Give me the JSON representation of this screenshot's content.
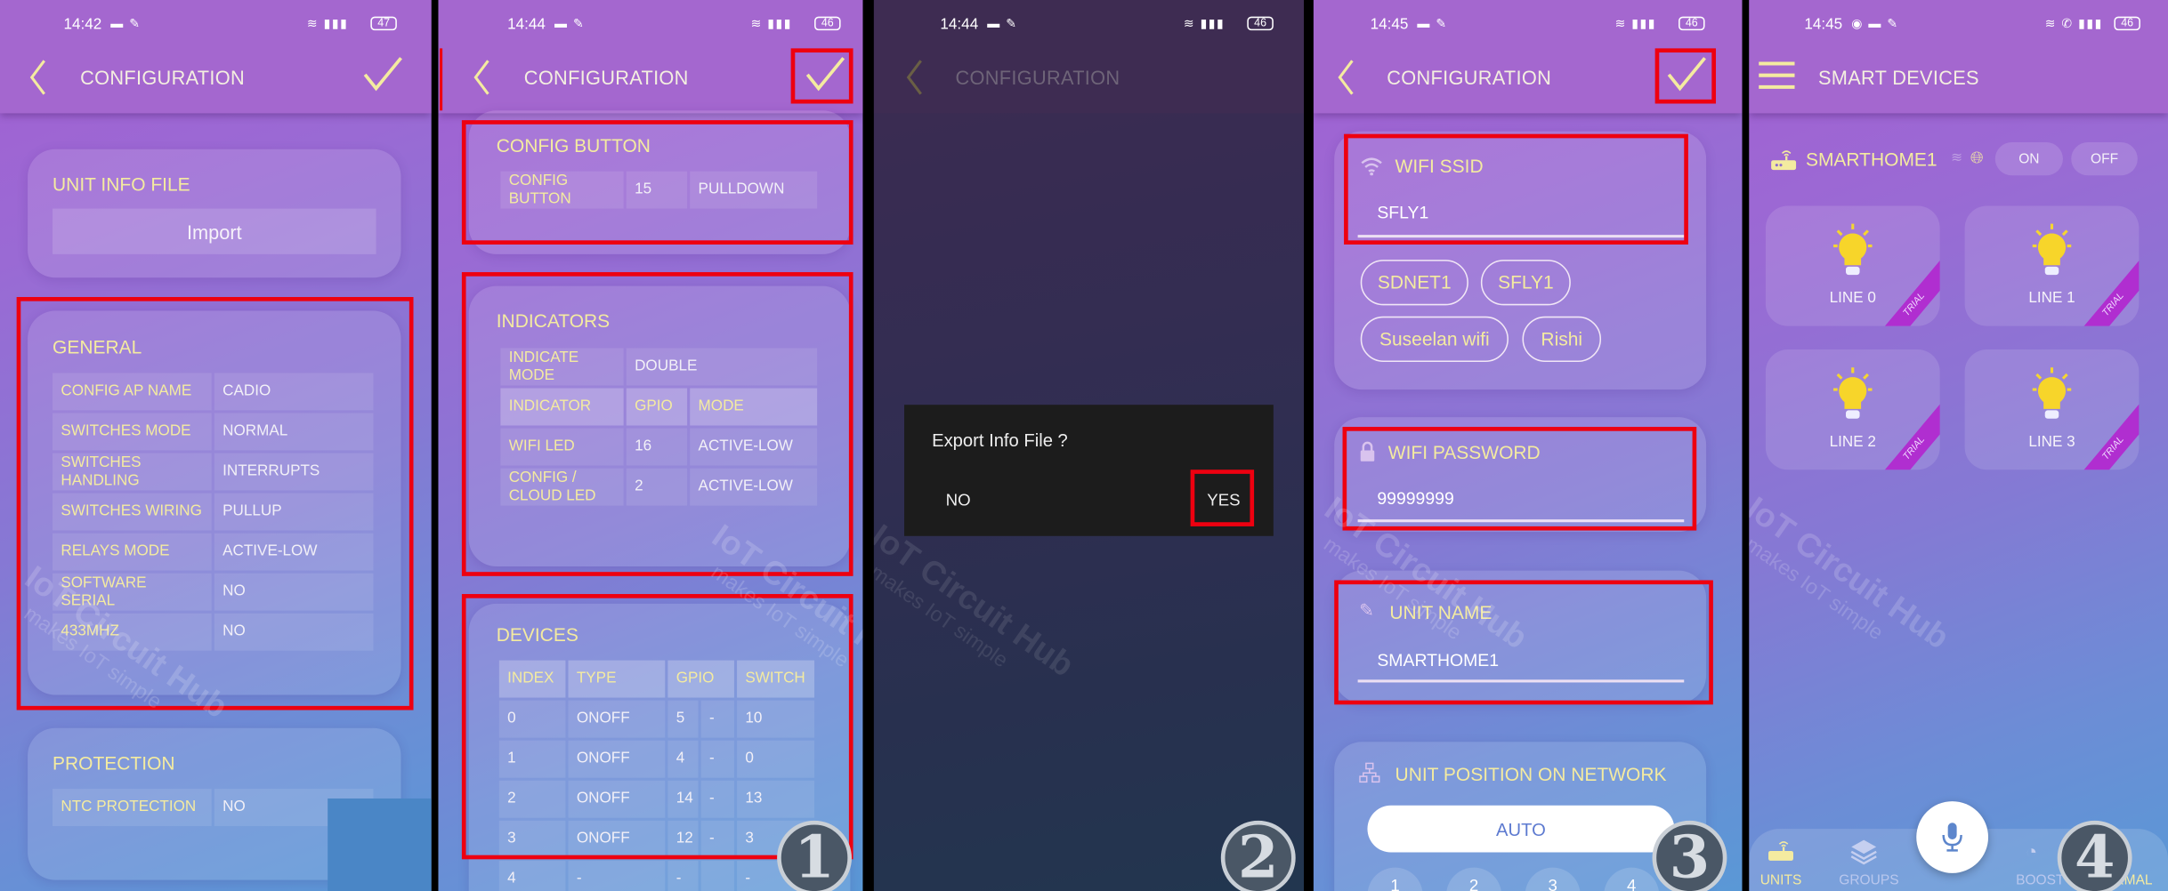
{
  "colors": {
    "accent_title": "#f4eba0",
    "highlight_box": "#ee0010",
    "header": "#a467cf",
    "dialog": "#1c1c1c",
    "trial_ribbon": "#b02ed0"
  },
  "watermark": {
    "line1": "IoT Circuit Hub",
    "line2": "makes IoT simple"
  },
  "screen1": {
    "status": {
      "time": "14:42",
      "battery": "47"
    },
    "header": {
      "title": "CONFIGURATION",
      "back_icon": "chevron-left-icon",
      "confirm_icon": "check-icon"
    },
    "unit_info": {
      "title": "UNIT INFO FILE",
      "import_label": "Import"
    },
    "general": {
      "title": "GENERAL",
      "rows": [
        [
          "CONFIG AP NAME",
          "CADIO"
        ],
        [
          "SWITCHES MODE",
          "NORMAL"
        ],
        [
          "SWITCHES HANDLING",
          "INTERRUPTS"
        ],
        [
          "SWITCHES WIRING",
          "PULLUP"
        ],
        [
          "RELAYS MODE",
          "ACTIVE-LOW"
        ],
        [
          "SOFTWARE SERIAL",
          "NO"
        ],
        [
          "433MHZ",
          "NO"
        ]
      ]
    },
    "protection": {
      "title": "PROTECTION",
      "rows": [
        [
          "NTC PROTECTION",
          "NO"
        ]
      ]
    }
  },
  "screen2": {
    "status": {
      "time": "14:44",
      "battery": "46"
    },
    "header": {
      "title": "CONFIGURATION"
    },
    "config_button": {
      "title": "CONFIG BUTTON",
      "rows": [
        [
          "CONFIG BUTTON",
          "15",
          "PULLDOWN"
        ]
      ]
    },
    "indicators": {
      "title": "INDICATORS",
      "mode_row": [
        "INDICATE MODE",
        "DOUBLE"
      ],
      "columns": [
        "INDICATOR",
        "GPIO",
        "MODE"
      ],
      "rows": [
        [
          "WIFI LED",
          "16",
          "ACTIVE-LOW"
        ],
        [
          "CONFIG / CLOUD LED",
          "2",
          "ACTIVE-LOW"
        ]
      ]
    },
    "devices": {
      "title": "DEVICES",
      "columns": [
        "INDEX",
        "TYPE",
        "GPIO",
        "SWITCH"
      ],
      "rows": [
        [
          "0",
          "ONOFF",
          "5",
          "-",
          "10"
        ],
        [
          "1",
          "ONOFF",
          "4",
          "-",
          "0"
        ],
        [
          "2",
          "ONOFF",
          "14",
          "-",
          "13"
        ],
        [
          "3",
          "ONOFF",
          "12",
          "-",
          "3"
        ],
        [
          "4",
          "-",
          "-",
          "",
          "-"
        ]
      ]
    },
    "step_badge": "1"
  },
  "screen3": {
    "status": {
      "time": "14:44",
      "battery": "46"
    },
    "header": {
      "title": "CONFIGURATION"
    },
    "dialog": {
      "message": "Export Info File ?",
      "no_label": "NO",
      "yes_label": "YES"
    },
    "step_badge": "2"
  },
  "screen4": {
    "status": {
      "time": "14:45",
      "battery": "46"
    },
    "header": {
      "title": "CONFIGURATION"
    },
    "wifi_ssid": {
      "label": "WIFI SSID",
      "value": "SFLY1",
      "suggestions": [
        "SDNET1",
        "SFLY1",
        "Suseelan wifi",
        "Rishi"
      ]
    },
    "wifi_password": {
      "label": "WIFI PASSWORD",
      "value": "99999999"
    },
    "unit_name": {
      "label": "UNIT NAME",
      "value": "SMARTHOME1"
    },
    "unit_position": {
      "label": "UNIT POSITION ON NETWORK",
      "auto_label": "AUTO",
      "options": [
        "1",
        "2",
        "3",
        "4"
      ]
    },
    "step_badge": "3"
  },
  "screen5": {
    "status": {
      "time": "14:45",
      "battery": "46"
    },
    "header": {
      "title": "SMART DEVICES",
      "menu_icon": "hamburger-icon"
    },
    "unit": {
      "name": "SMARTHOME1",
      "on_label": "ON",
      "off_label": "OFF"
    },
    "devices": [
      {
        "label": "LINE 0",
        "badge": "TRIAL"
      },
      {
        "label": "LINE 1",
        "badge": "TRIAL"
      },
      {
        "label": "LINE 2",
        "badge": "TRIAL"
      },
      {
        "label": "LINE 3",
        "badge": "TRIAL"
      }
    ],
    "nav": {
      "units": "UNITS",
      "groups": "GROUPS",
      "boost": "BOOST",
      "normal": "NORMAL",
      "active": "UNITS"
    },
    "step_badge": "4"
  }
}
